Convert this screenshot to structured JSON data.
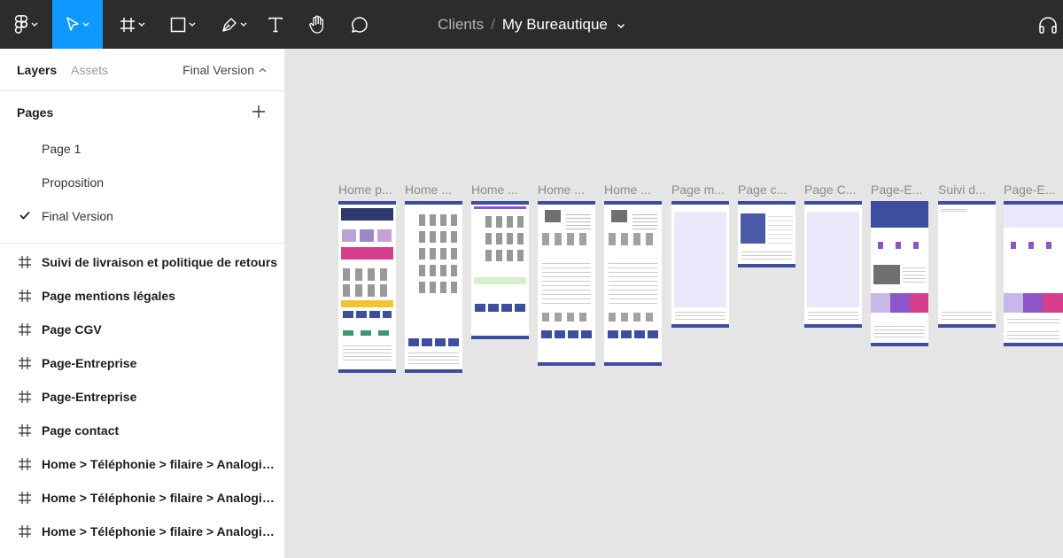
{
  "toolbar": {
    "tools": [
      {
        "name": "main-menu",
        "icon": "figma-logo-icon"
      },
      {
        "name": "move-tool",
        "icon": "cursor-icon",
        "active": true
      },
      {
        "name": "frame-tool",
        "icon": "frame-icon"
      },
      {
        "name": "shape-tool",
        "icon": "rectangle-icon"
      },
      {
        "name": "pen-tool",
        "icon": "pen-icon"
      },
      {
        "name": "text-tool",
        "icon": "text-icon"
      },
      {
        "name": "hand-tool",
        "icon": "hand-icon"
      },
      {
        "name": "comment-tool",
        "icon": "comment-icon"
      }
    ],
    "breadcrumb": {
      "parent": "Clients",
      "separator": "/",
      "current": "My Bureautique"
    },
    "right_icon": "headphones-icon",
    "active_color": "#0d99ff"
  },
  "panel": {
    "tabs": {
      "layers": "Layers",
      "assets": "Assets"
    },
    "version": "Final Version",
    "pages_title": "Pages",
    "pages": [
      {
        "label": "Page 1",
        "selected": false
      },
      {
        "label": "Proposition",
        "selected": false
      },
      {
        "label": "Final Version",
        "selected": true
      }
    ],
    "layers": [
      "Suivi de livraison et politique de retours",
      "Page mentions légales",
      "Page CGV",
      "Page-Entreprise",
      "Page-Entreprise",
      "Page contact",
      "Home > Téléphonie > filaire > Analogiq...",
      "Home > Téléphonie > filaire > Analogiq...",
      "Home > Téléphonie > filaire > Analogique"
    ]
  },
  "canvas": {
    "background": "#e5e5e5",
    "frame_labels": [
      "Home p...",
      "Home ...",
      "Home ...",
      "Home ...",
      "Home ...",
      "Page m...",
      "Page c...",
      "Page C...",
      "Page-E...",
      "Suivi d...",
      "Page-E..."
    ],
    "brand_colors": {
      "navy": "#3d4e9e",
      "pink": "#d63f8c",
      "purple": "#8e55c8",
      "yellow": "#f4c430",
      "lavender": "#ece8fb"
    }
  }
}
